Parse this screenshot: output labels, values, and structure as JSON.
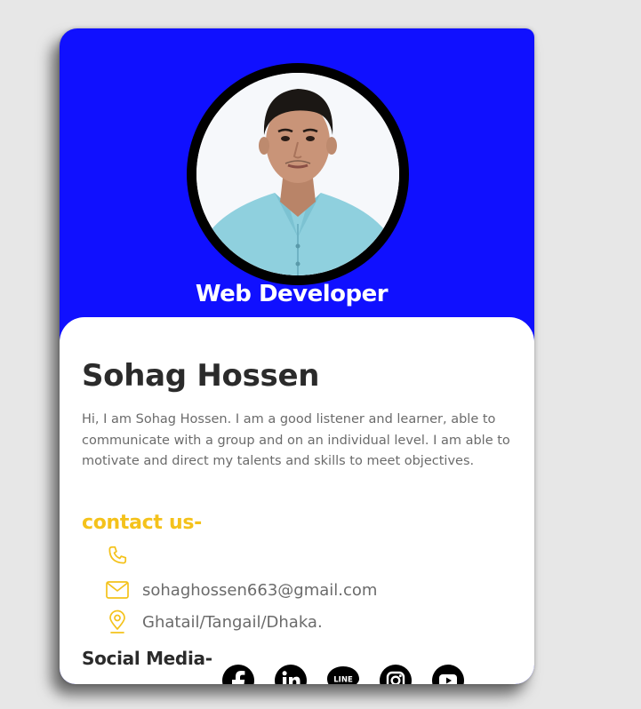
{
  "profile": {
    "role": "Web Developer",
    "name": "Sohag Hossen",
    "bio": "Hi, I am Sohag Hossen. I am a good listener and learner, able to communicate with a group and on an individual level. I am able to motivate and direct my talents and skills to meet objectives."
  },
  "contact": {
    "heading": "contact us-",
    "items": [
      {
        "icon": "phone-icon",
        "text": ""
      },
      {
        "icon": "mail-icon",
        "text": "sohaghossen663@gmail.com"
      },
      {
        "icon": "location-pin-icon",
        "text": "Ghatail/Tangail/Dhaka."
      }
    ]
  },
  "social": {
    "heading": "Social Media-",
    "icons": [
      "facebook-icon",
      "linkedin-icon",
      "line-icon",
      "instagram-icon",
      "youtube-icon"
    ],
    "line_label": "LINE"
  },
  "colors": {
    "header": "#1010ff",
    "accent": "#f4c21b",
    "text_dark": "#2b2b2b",
    "text_muted": "#6b6b6b"
  }
}
